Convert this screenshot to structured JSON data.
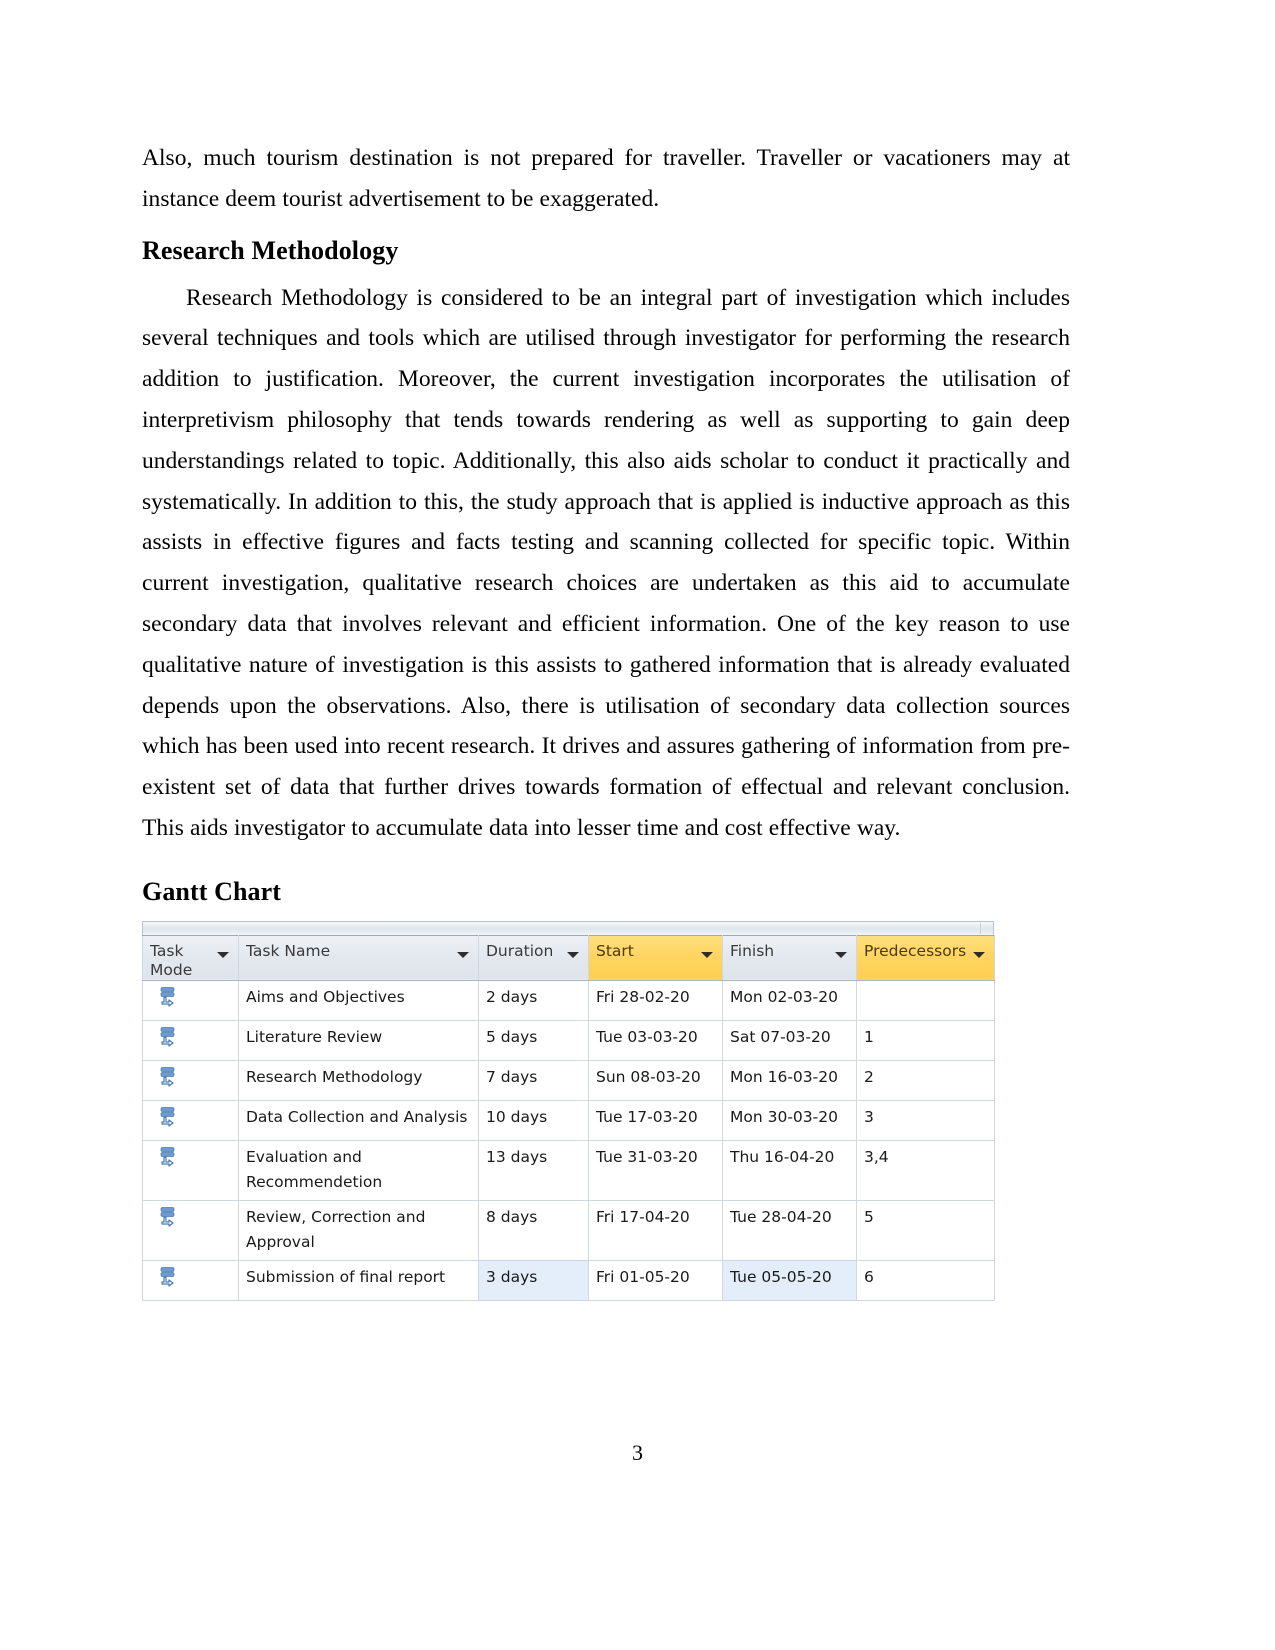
{
  "document": {
    "page_number": "3",
    "paragraphs": [
      "Also, much tourism destination is not prepared for traveller. Traveller or vacationers may at instance deem tourist advertisement to be exaggerated."
    ],
    "heading_research": "Research Methodology",
    "paragraph_research": "Research Methodology is considered to be an integral part of investigation which includes several techniques and tools which are utilised through investigator for performing the research addition to justification. Moreover, the current investigation incorporates the utilisation of interpretivism philosophy that tends towards rendering as well as supporting to gain deep understandings related to topic. Additionally, this also aids scholar to conduct it practically and systematically. In addition to this, the study approach that is applied is inductive approach as this assists in effective figures and facts testing and scanning collected for specific topic. Within current investigation, qualitative research choices are undertaken as this aid to accumulate secondary data that involves relevant and efficient information. One of the key reason to use qualitative nature of investigation is this assists to gathered information that is already evaluated depends upon the observations. Also, there is utilisation of secondary data collection sources which has been used into recent research. It drives and assures gathering of information from pre-existent set of data that further drives towards formation of effectual and relevant conclusion. This aids investigator to accumulate data into lesser time and cost effective way.",
    "heading_gantt": "Gantt Chart"
  },
  "gantt_table": {
    "columns": [
      {
        "label": "Task\nMode",
        "key": "task_mode",
        "highlight": false,
        "caret": true
      },
      {
        "label": "Task Name",
        "key": "task_name",
        "highlight": false,
        "caret": true
      },
      {
        "label": "Duration",
        "key": "duration",
        "highlight": false,
        "caret": true
      },
      {
        "label": "Start",
        "key": "start",
        "highlight": true,
        "caret": true
      },
      {
        "label": "Finish",
        "key": "finish",
        "highlight": false,
        "caret": true
      },
      {
        "label": "Predecessors",
        "key": "predecessors",
        "highlight": true,
        "caret": true
      }
    ],
    "rows": [
      {
        "mode_icon": "manually-scheduled-icon",
        "task_name": "Aims and Objectives",
        "duration": "2 days",
        "start": "Fri 28-02-20",
        "finish": "Mon 02-03-20",
        "predecessors": "",
        "selected": false
      },
      {
        "mode_icon": "manually-scheduled-icon",
        "task_name": "Literature Review",
        "duration": "5 days",
        "start": "Tue 03-03-20",
        "finish": "Sat 07-03-20",
        "predecessors": "1",
        "selected": false
      },
      {
        "mode_icon": "manually-scheduled-icon",
        "task_name": "Research Methodology",
        "duration": "7 days",
        "start": "Sun 08-03-20",
        "finish": "Mon 16-03-20",
        "predecessors": "2",
        "selected": false
      },
      {
        "mode_icon": "manually-scheduled-icon",
        "task_name": "Data Collection and Analysis",
        "duration": "10 days",
        "start": "Tue 17-03-20",
        "finish": "Mon 30-03-20",
        "predecessors": "3",
        "selected": false
      },
      {
        "mode_icon": "manually-scheduled-icon",
        "task_name": "Evaluation and Recommendetion",
        "duration": "13 days",
        "start": "Tue 31-03-20",
        "finish": "Thu 16-04-20",
        "predecessors": "3,4",
        "selected": false
      },
      {
        "mode_icon": "manually-scheduled-icon",
        "task_name": "Review, Correction and Approval",
        "duration": "8 days",
        "start": "Fri 17-04-20",
        "finish": "Tue 28-04-20",
        "predecessors": "5",
        "selected": false
      },
      {
        "mode_icon": "manually-scheduled-icon",
        "task_name": "Submission of final report",
        "duration": "3 days",
        "start": "Fri 01-05-20",
        "finish": "Tue 05-05-20",
        "predecessors": "6",
        "selected": true
      }
    ],
    "colors": {
      "header_highlight": "#ffd45f",
      "header_normal": "#e2e8ee",
      "selection": "#e4eefb",
      "grid_line": "#cfd8e0",
      "icon_blue": "#6f9ad1"
    }
  }
}
